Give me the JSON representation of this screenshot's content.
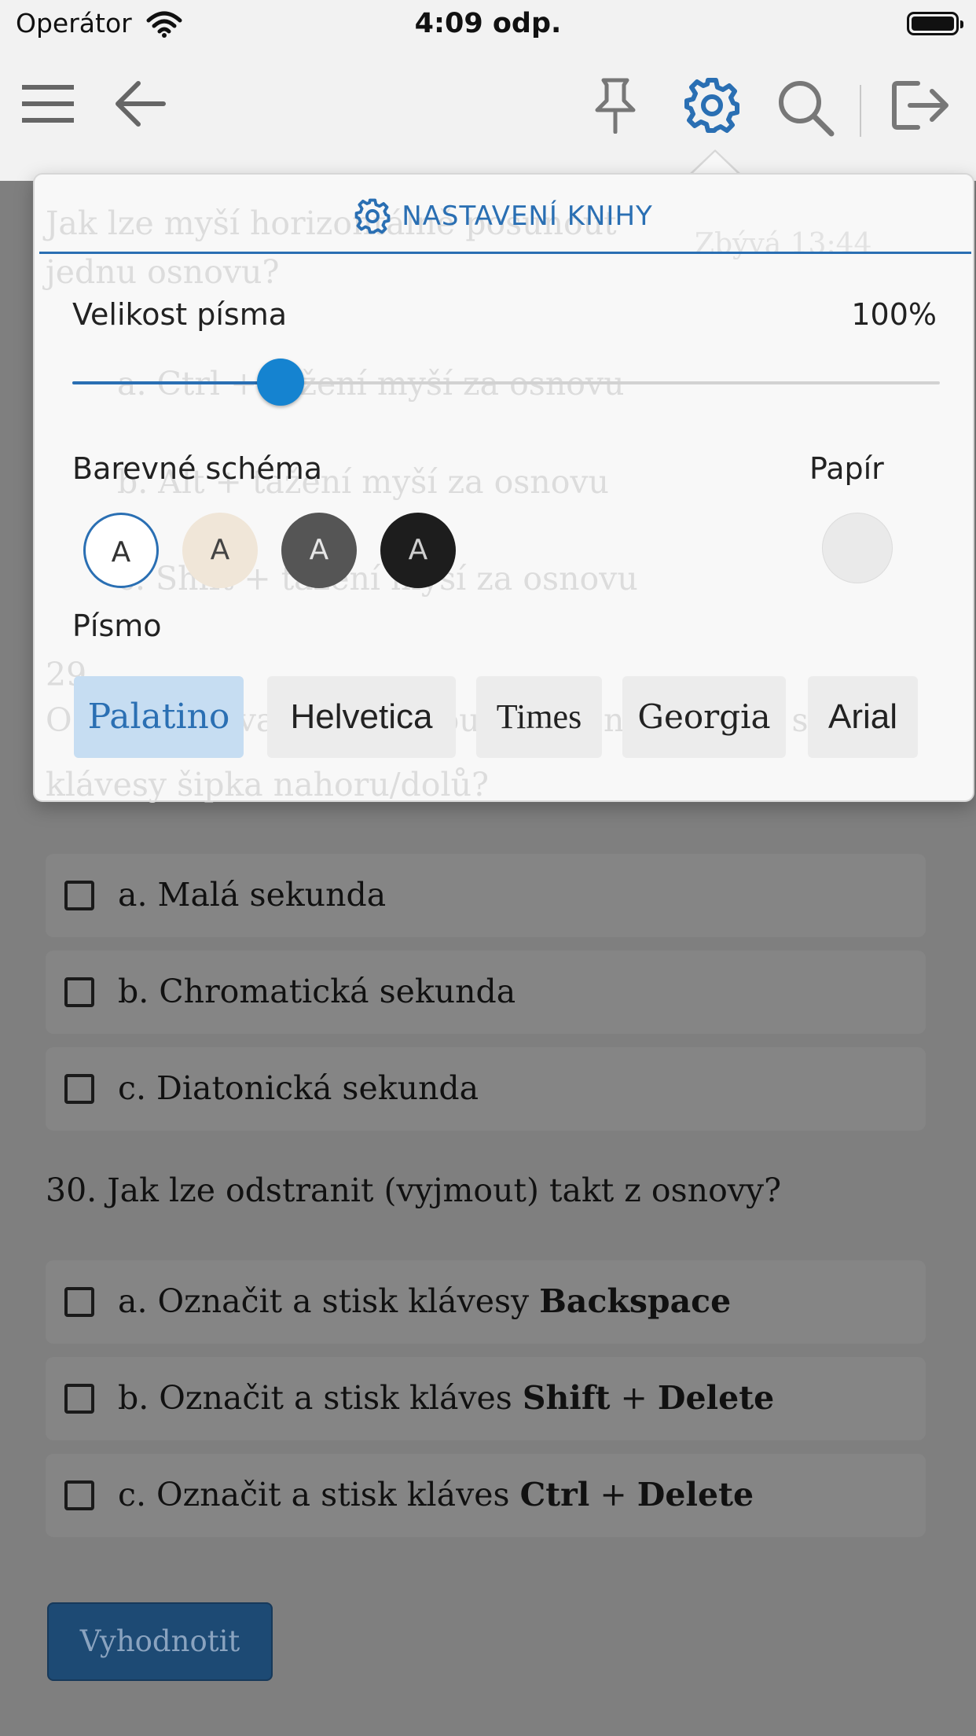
{
  "status_bar": {
    "carrier": "Operátor",
    "time": "4:09 odp."
  },
  "toolbar": {
    "icons": [
      "menu-icon",
      "back-arrow-icon",
      "pin-icon",
      "gear-icon",
      "search-icon",
      "exit-icon"
    ]
  },
  "background": {
    "ghost_lines": [
      "Jak lze myší horizontálně posunout",
      "jednu osnovu?",
      "a. Ctrl + tažení myší za osnovu",
      "b. Alt + tažení myší za osnovu",
      "c. Shift + tažení myší za osnovu",
      "29.",
      "O jaký interval se posunou označené noty při stisku",
      "klávesy šipka nahoru/dolů?",
      "Zbývá 13:44"
    ],
    "q29_answers": [
      "a. Malá sekunda",
      "b. Chromatická sekunda",
      "c. Diatonická sekunda"
    ],
    "q30": {
      "question": "30. Jak lze odstranit (vyjmout) takt z osnovy?",
      "answers": [
        {
          "text": "a. Označit a stisk klávesy ",
          "bold1": "Backspace",
          "mid": "",
          "bold2": ""
        },
        {
          "text": "b. Označit a stisk kláves ",
          "bold1": "Shift",
          "mid": " + ",
          "bold2": "Delete"
        },
        {
          "text": "c. Označit a stisk kláves ",
          "bold1": "Ctrl",
          "mid": " + ",
          "bold2": "Delete"
        }
      ]
    },
    "submit_button": "Vyhodnotit"
  },
  "popover": {
    "title": "NASTAVENÍ KNIHY",
    "font_size_label": "Velikost písma",
    "font_size_value": "100%",
    "font_size_level": 0.24,
    "color_scheme_label": "Barevné schéma",
    "schemes": [
      {
        "letter": "A",
        "bg": "#ffffff",
        "fg": "#333333",
        "border": "#2a6fb3"
      },
      {
        "letter": "A",
        "bg": "#f0e6d8",
        "fg": "#444444",
        "border": "none"
      },
      {
        "letter": "A",
        "bg": "#555555",
        "fg": "#e6e6e6",
        "border": "none"
      },
      {
        "letter": "A",
        "bg": "#1d1d1d",
        "fg": "#cfcfcf",
        "border": "none"
      }
    ],
    "paper_label": "Papír",
    "font_label": "Písmo",
    "fonts": [
      "Palatino",
      "Helvetica",
      "Times",
      "Georgia",
      "Arial"
    ],
    "selected_font": "Palatino"
  },
  "colors": {
    "accent": "#2a6fb3",
    "slider_thumb": "#1583d0",
    "submit_bg": "#1d4a74"
  }
}
